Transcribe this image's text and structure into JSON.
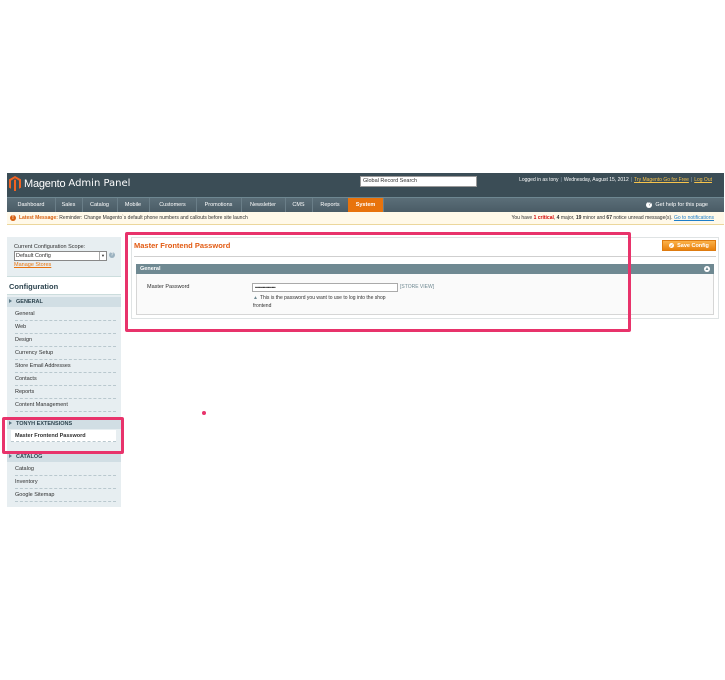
{
  "header": {
    "logo_name": "Magento",
    "logo_tag": "Admin Panel",
    "search_value": "Global Record Search",
    "logged_in": "Logged in as tony",
    "date": "Wednesday, August 15, 2012",
    "try_link": "Try Magento Go for Free",
    "logout_link": "Log Out"
  },
  "nav": {
    "items": [
      "Dashboard",
      "Sales",
      "Catalog",
      "Mobile",
      "Customers",
      "Promotions",
      "Newsletter",
      "CMS",
      "Reports",
      "System"
    ],
    "active": "System",
    "help": "Get help for this page"
  },
  "message": {
    "label": "Latest Message:",
    "text": "Reminder: Change Magento`s default phone numbers and callouts before site launch",
    "right_prefix": "You have",
    "critical": "1 critical",
    "major": "4",
    "major_label": "major,",
    "minor": "19",
    "minor_label": "minor and",
    "notice": "67",
    "notice_label": "notice unread message(s).",
    "link": "Go to notifications"
  },
  "sidebar": {
    "scope_label": "Current Configuration Scope:",
    "scope_value": "Default Config",
    "manage_stores": "Manage Stores",
    "config_title": "Configuration",
    "sections": [
      {
        "label": "GENERAL",
        "items": [
          "General",
          "Web",
          "Design",
          "Currency Setup",
          "Store Email Addresses",
          "Contacts",
          "Reports",
          "Content Management"
        ]
      },
      {
        "label": "TONYH EXTENSIONS",
        "items": [
          "Master Frontend Password"
        ]
      },
      {
        "label": "CATALOG",
        "items": [
          "Catalog",
          "Inventory",
          "Google Sitemap"
        ]
      }
    ]
  },
  "main": {
    "title": "Master Frontend Password",
    "save_button": "Save Config",
    "fieldset": "General",
    "field_label": "Master Password",
    "field_value": "••••••••••••••••",
    "field_scope": "[STORE VIEW]",
    "field_note": "This is the password you want to use to log into the shop frontend"
  },
  "colors": {
    "header": "#3b4d56",
    "accent": "#e8730c",
    "highlight": "#e8336b"
  }
}
